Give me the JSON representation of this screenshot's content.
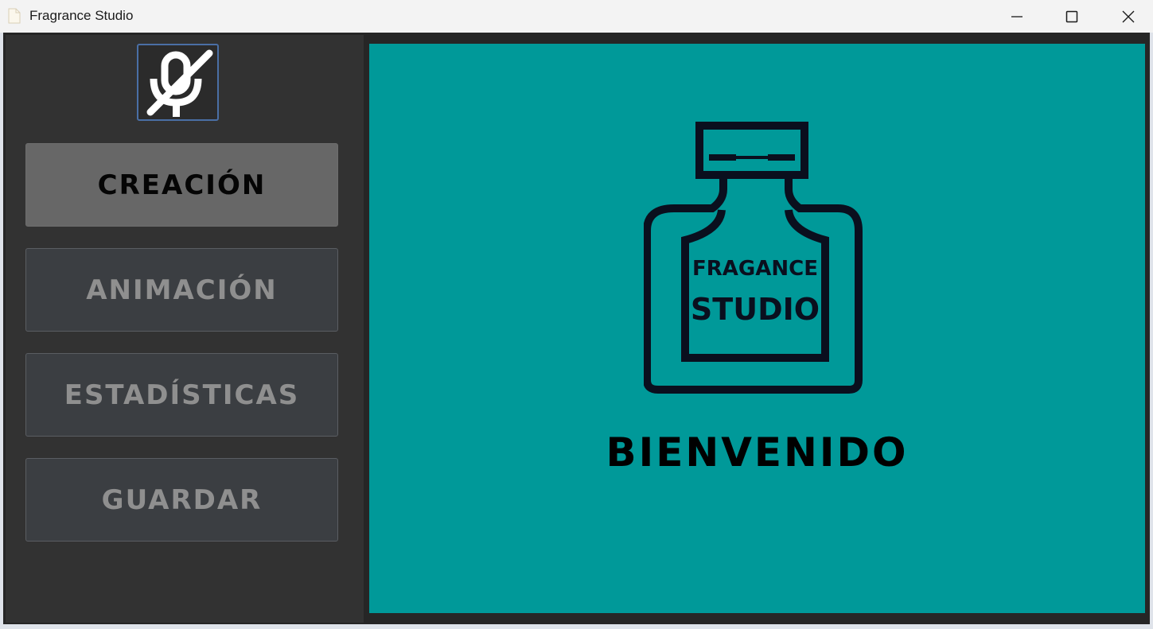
{
  "window": {
    "title": "Fragrance Studio",
    "app_icon": "app-icon",
    "controls": [
      "minimize-icon",
      "maximize-icon",
      "close-icon"
    ]
  },
  "sidebar": {
    "logo_icon": "mic-off-icon",
    "buttons": [
      {
        "label": "CREACIÓN",
        "active": true
      },
      {
        "label": "ANIMACIÓN",
        "active": false
      },
      {
        "label": "ESTADÍSTICAS",
        "active": false
      },
      {
        "label": "GUARDAR",
        "active": false
      }
    ]
  },
  "main": {
    "logo": {
      "icon": "perfume-bottle-icon",
      "line1": "FRAGANCE",
      "line2": "STUDIO"
    },
    "welcome": "BIENVENIDO"
  },
  "colors": {
    "content_bg": "#009999",
    "sidebar_bg": "#323232",
    "active_button": "#676767",
    "inactive_button": "#3b3e42",
    "inactive_text": "#8f8f8f"
  }
}
